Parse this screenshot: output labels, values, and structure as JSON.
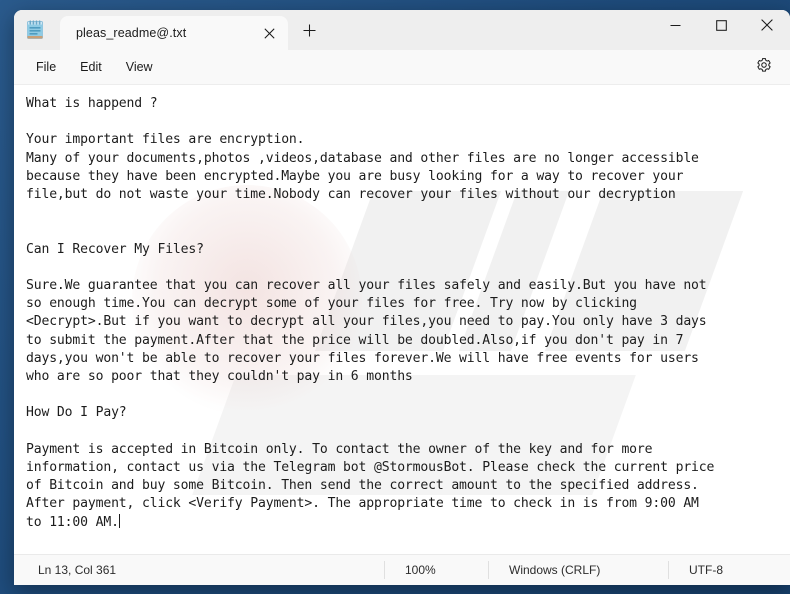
{
  "window": {
    "app_name": "Notepad",
    "app_icon": "notepad-icon"
  },
  "tabs": [
    {
      "label": "pleas_readme@.txt",
      "close_icon": "close-icon",
      "active": true
    }
  ],
  "newtab": {
    "icon": "plus-icon",
    "tooltip": "New tab"
  },
  "caption": {
    "minimize": "minimize-icon",
    "maximize": "maximize-icon",
    "close": "close-icon"
  },
  "menubar": {
    "items": [
      {
        "label": "File"
      },
      {
        "label": "Edit"
      },
      {
        "label": "View"
      }
    ],
    "settings_icon": "gear-icon"
  },
  "document": {
    "text": "What is happend ?\n\nYour important files are encryption.\nMany of your documents,photos ,videos,database and other files are no longer accessible\nbecause they have been encrypted.Maybe you are busy looking for a way to recover your\nfile,but do not waste your time.Nobody can recover your files without our decryption\n\n\nCan I Recover My Files?\n\nSure.We guarantee that you can recover all your files safely and easily.But you have not\nso enough time.You can decrypt some of your files for free. Try now by clicking\n<Decrypt>.But if you want to decrypt all your files,you need to pay.You only have 3 days\nto submit the payment.After that the price will be doubled.Also,if you don't pay in 7\ndays,you won't be able to recover your files forever.We will have free events for users\nwho are so poor that they couldn't pay in 6 months\n\nHow Do I Pay?\n\nPayment is accepted in Bitcoin only. To contact the owner of the key and for more\ninformation, contact us via the Telegram bot @StormousBot. Please check the current price\nof Bitcoin and buy some Bitcoin. Then send the correct amount to the specified address.\nAfter payment, click <Verify Payment>. The appropriate time to check in is from 9:00 AM\nto 11:00 AM."
  },
  "statusbar": {
    "position": "Ln 13, Col 361",
    "zoom": "100%",
    "line_ending": "Windows (CRLF)",
    "encoding": "UTF-8"
  },
  "colors": {
    "desktop": "#1f4e79",
    "window_chrome": "#eeeeee",
    "surface": "#f9f9f9",
    "editor_background": "#ffffff",
    "text": "#1c1c1c"
  }
}
